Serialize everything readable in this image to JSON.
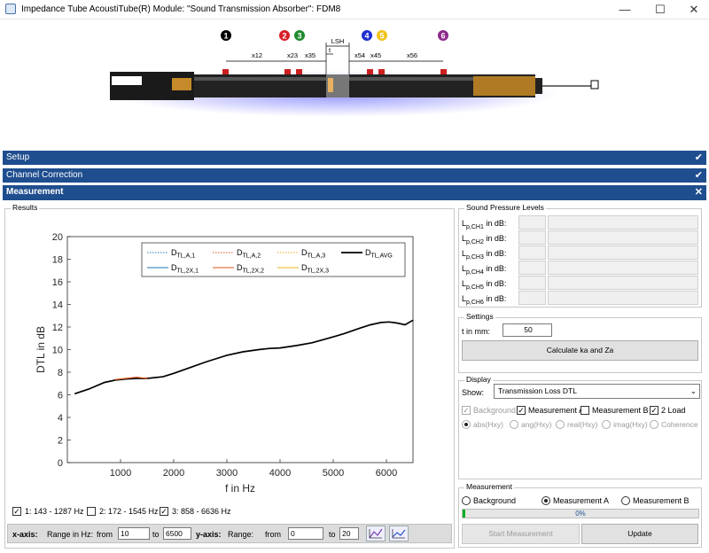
{
  "window": {
    "title": "Impedance Tube AcoustiTube(R) Module: \"Sound Transmission Absorber\": FDM8",
    "minimize": "—",
    "maximize": "☐",
    "close": "✕"
  },
  "diagram": {
    "mic_numbers": [
      "1",
      "2",
      "3",
      "4",
      "5",
      "6"
    ],
    "mic_colors": [
      "#000000",
      "#d81f26",
      "#1f8a2e",
      "#1f2fcf",
      "#f2c21a",
      "#8e2a8c"
    ],
    "dimensions": [
      "x12",
      "x23",
      "x35",
      "LSH",
      "t",
      "x54",
      "x45",
      "x56"
    ]
  },
  "sections": {
    "setup": "Setup",
    "channel_correction": "Channel Correction",
    "measurement": "Measurement"
  },
  "results": {
    "label": "Results",
    "ranges": [
      {
        "label": "1: 143 - 1287 Hz",
        "checked": true
      },
      {
        "label": "2: 172 - 1545 Hz",
        "checked": false
      },
      {
        "label": "3: 858 - 6636 Hz",
        "checked": true
      }
    ],
    "xaxis_label": "x-axis:",
    "range_hz_label": "Range in Hz:",
    "from_label": "from",
    "from_x": "10",
    "to_label": "to",
    "to_x": "6500",
    "yaxis_label": "y-axis:",
    "range_label": "Range:",
    "from_y": "0",
    "to_y": "20"
  },
  "chart_data": {
    "type": "line",
    "xlabel": "f in Hz",
    "ylabel": "DTL in dB",
    "xlim": [
      0,
      6500
    ],
    "ylim": [
      0,
      20
    ],
    "xticks": [
      1000,
      2000,
      3000,
      4000,
      5000,
      6000
    ],
    "yticks": [
      0,
      2,
      4,
      6,
      8,
      10,
      12,
      14,
      16,
      18,
      20
    ],
    "grid": false,
    "legend": "top-right",
    "legend_entries": [
      {
        "name": "DTL,A,1",
        "color": "#1f77b4",
        "style": "dotted"
      },
      {
        "name": "DTL,A,2",
        "color": "#d95319",
        "style": "dotted"
      },
      {
        "name": "DTL,A,3",
        "color": "#edb120",
        "style": "dotted"
      },
      {
        "name": "DTL,AVG",
        "color": "#000000",
        "style": "solid"
      },
      {
        "name": "DTL,2X,1",
        "color": "#1f77b4",
        "style": "solid"
      },
      {
        "name": "DTL,2X,2",
        "color": "#d95319",
        "style": "solid"
      },
      {
        "name": "DTL,2X,3",
        "color": "#edb120",
        "style": "solid"
      }
    ],
    "series": [
      {
        "name": "DTL,AVG",
        "x": [
          143,
          400,
          700,
          900,
          1100,
          1300,
          1500,
          1800,
          2000,
          2300,
          2600,
          3000,
          3300,
          3600,
          3800,
          4000,
          4300,
          4600,
          4900,
          5200,
          5500,
          5700,
          5900,
          6050,
          6200,
          6350,
          6500
        ],
        "y": [
          6.1,
          6.5,
          7.1,
          7.3,
          7.4,
          7.45,
          7.45,
          7.6,
          7.9,
          8.4,
          8.9,
          9.5,
          9.8,
          10.0,
          10.1,
          10.15,
          10.35,
          10.6,
          11.0,
          11.4,
          11.9,
          12.2,
          12.4,
          12.45,
          12.35,
          12.2,
          12.6
        ]
      },
      {
        "name": "DTL,2X,2",
        "x": [
          900,
          1100,
          1300,
          1500
        ],
        "y": [
          7.35,
          7.45,
          7.55,
          7.45
        ]
      }
    ]
  },
  "spl": {
    "label": "Sound Pressure Levels",
    "rows": [
      "Lp,CH1 in dB:",
      "Lp,CH2 in dB:",
      "Lp,CH3 in dB:",
      "Lp,CH4 in dB:",
      "Lp,CH5 in dB:",
      "Lp,CH6 in dB:"
    ],
    "row_sub": [
      "p,CH1",
      "p,CH2",
      "p,CH3",
      "p,CH4",
      "p,CH5",
      "p,CH6"
    ]
  },
  "settings": {
    "label": "Settings",
    "t_label": "t in mm:",
    "t_value": "50",
    "calc_button": "Calculate ka and Za"
  },
  "display": {
    "label": "Display",
    "show_label": "Show:",
    "show_value": "Transmission Loss DTL",
    "checks": [
      {
        "label": "Background",
        "checked": true,
        "enabled": false
      },
      {
        "label": "Measurement A",
        "checked": true,
        "enabled": true
      },
      {
        "label": "Measurement B",
        "checked": false,
        "enabled": true
      },
      {
        "label": "2 Load",
        "checked": true,
        "enabled": true
      }
    ],
    "radios": [
      "abs(Hxy)",
      "ang(Hxy)",
      "real(Hxy)",
      "imag(Hxy)",
      "Coherence"
    ]
  },
  "measurement": {
    "label": "Measurement",
    "radios": [
      "Background",
      "Measurement A",
      "Measurement B"
    ],
    "selected": "Measurement A",
    "progress_text": "0%",
    "progress_value": 0.01,
    "start_button": "Start Measurement",
    "update_button": "Update"
  }
}
